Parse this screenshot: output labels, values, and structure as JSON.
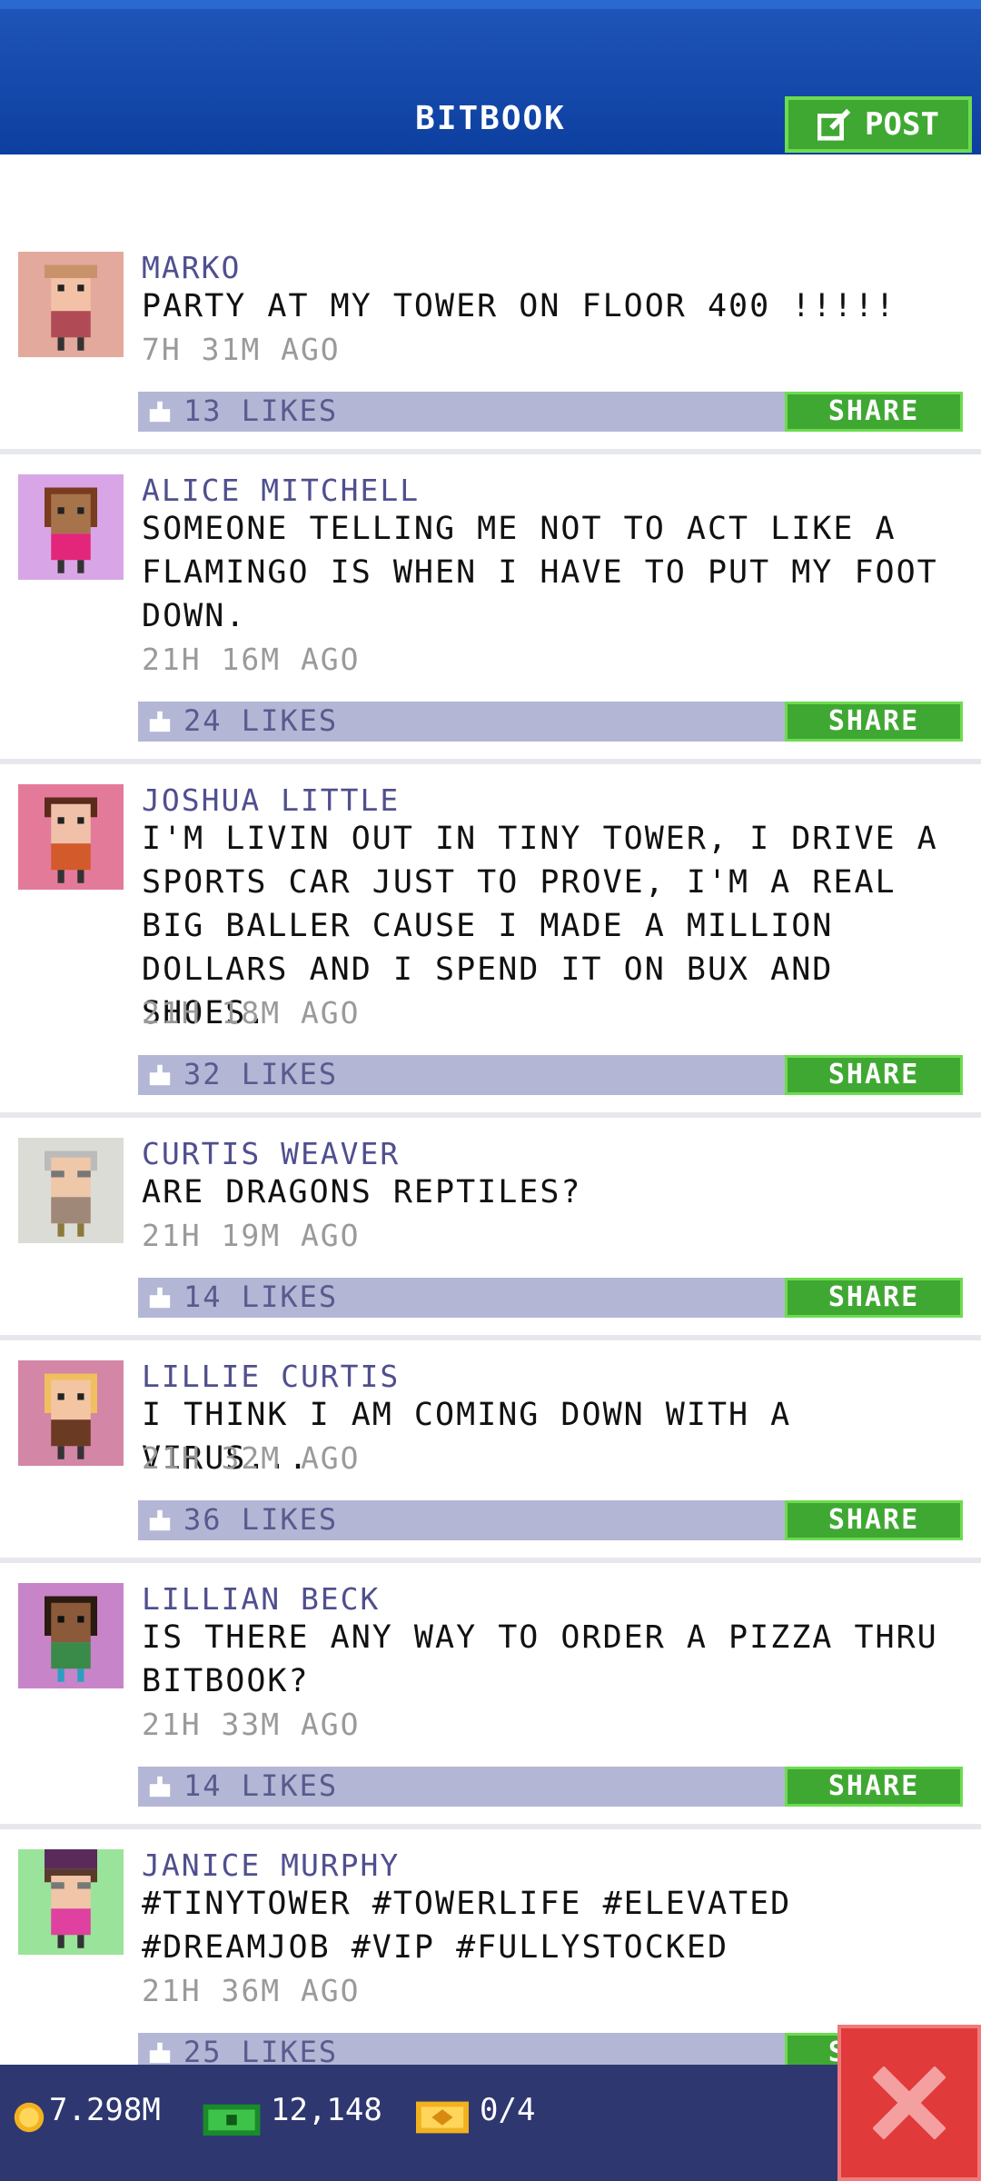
{
  "header": {
    "title": "BITBOOK",
    "post_label": "POST"
  },
  "posts": [
    {
      "name": "MARKO",
      "text": "PARTY AT MY TOWER ON FLOOR 400 !!!!!",
      "time": "7H 31M AGO",
      "likes": "13 LIKES",
      "share": "SHARE",
      "avatar_bg": "#e3a99c",
      "skin": "#f3c2a6",
      "hair": "#c9926a",
      "shirt": "#b04b55"
    },
    {
      "name": "ALICE MITCHELL",
      "text": "SOMEONE TELLING ME NOT TO ACT LIKE A FLAMINGO IS WHEN I HAVE TO PUT MY FOOT DOWN.",
      "time": "21H 16M AGO",
      "likes": "24 LIKES",
      "share": "SHARE",
      "avatar_bg": "#d8a6e6",
      "skin": "#a7734a",
      "hair": "#7a3c1f",
      "shirt": "#e3267a"
    },
    {
      "name": "JOSHUA LITTLE",
      "text": "I'M LIVIN OUT IN TINY TOWER, I DRIVE A SPORTS CAR JUST TO PROVE, I'M A REAL BIG BALLER CAUSE I MADE A MILLION DOLLARS AND I SPEND IT ON BUX AND SHOES.",
      "time": "21H 18M AGO",
      "likes": "32 LIKES",
      "share": "SHARE",
      "avatar_bg": "#e47a9a",
      "skin": "#f0c0a8",
      "hair": "#5a2a1a",
      "shirt": "#d35a2a"
    },
    {
      "name": "CURTIS WEAVER",
      "text": "ARE DRAGONS REPTILES?",
      "time": "21H 19M AGO",
      "likes": "14 LIKES",
      "share": "SHARE",
      "avatar_bg": "#dcdcd6",
      "skin": "#efc7a9",
      "hair": "#bbbbbb",
      "shirt": "#a08878"
    },
    {
      "name": "LILLIE CURTIS",
      "text": "I THINK I AM COMING DOWN WITH A VIRUS...",
      "time": "21H 32M AGO",
      "likes": "36 LIKES",
      "share": "SHARE",
      "avatar_bg": "#d486a6",
      "skin": "#f3c5a3",
      "hair": "#f0c060",
      "shirt": "#6b3a22"
    },
    {
      "name": "LILLIAN BECK",
      "text": "IS THERE ANY WAY TO ORDER A PIZZA THRU BITBOOK?",
      "time": "21H 33M AGO",
      "likes": "14 LIKES",
      "share": "SHARE",
      "avatar_bg": "#c884c8",
      "skin": "#8a5a3a",
      "hair": "#2a1a10",
      "shirt": "#3a8a4a"
    },
    {
      "name": "JANICE MURPHY",
      "text": "#TINYTOWER #TOWERLIFE #ELEVATED #DREAMJOB #VIP #FULLYSTOCKED",
      "time": "21H 36M AGO",
      "likes": "25 LIKES",
      "share": "SHARE",
      "avatar_bg": "#9ae39a",
      "skin": "#f0c5a8",
      "hair": "#5a3a2a",
      "shirt": "#e040a0"
    }
  ],
  "footer": {
    "coins": "7.298M",
    "bux": "12,148",
    "tickets": "0/4"
  },
  "colors": {
    "header": "#0c3f9f",
    "share_green": "#3fa832",
    "likes_bar": "#b4b6d6",
    "footer": "#2e3770",
    "close_red": "#e13a3a"
  },
  "icons": {
    "post": "edit-icon",
    "like": "thumbs-up-icon",
    "coin": "coin-icon",
    "bux": "bux-icon",
    "ticket": "ticket-icon",
    "close": "close-icon"
  }
}
